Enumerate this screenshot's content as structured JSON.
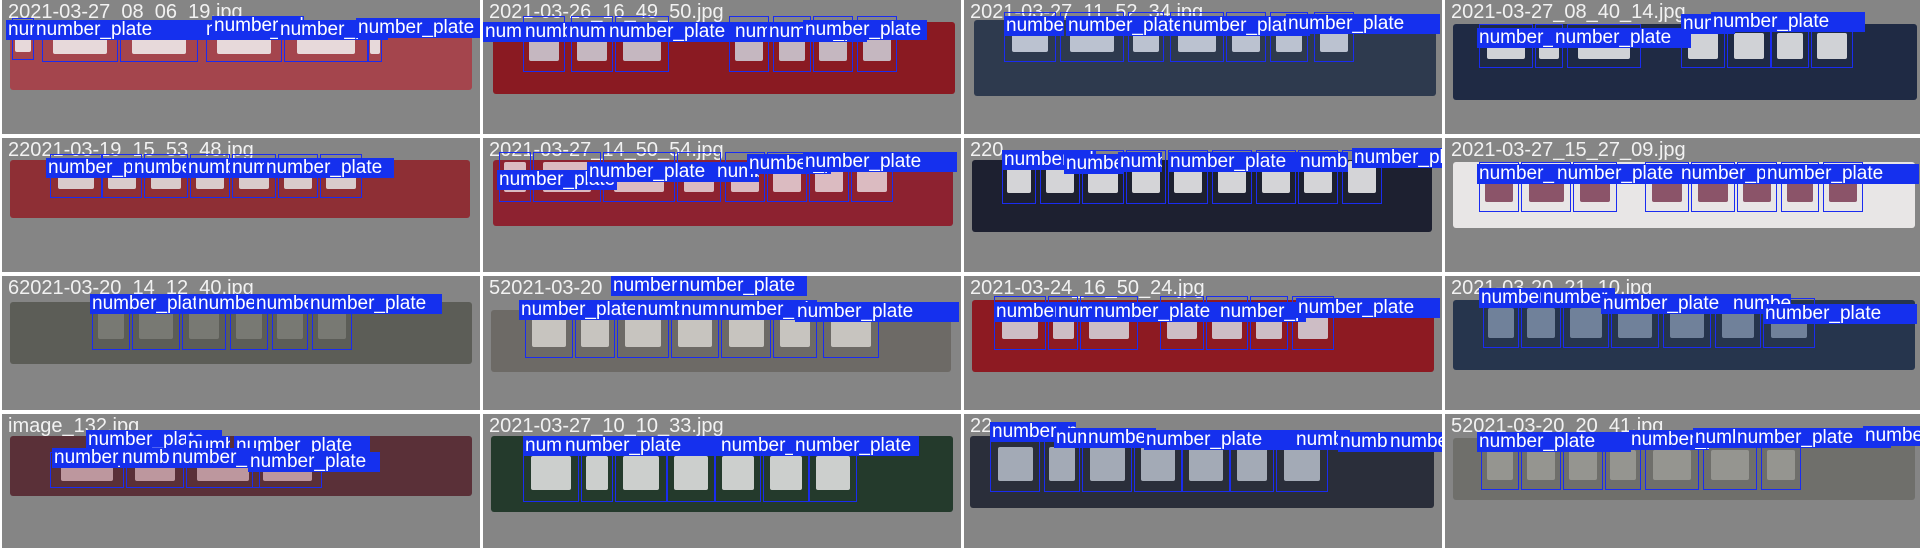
{
  "label_text": "number_plate",
  "colors": {
    "box": "#1a2cf0",
    "tag_bg": "#1530ee",
    "tag_text": "#ffffff",
    "tile_bg": "#858585",
    "filename_text": "#f2f2f2"
  },
  "tiles": [
    {
      "filename": "2021-03-27_08_06_19.jpg",
      "plate_color": "#a4454d",
      "glyph_color": "#f3f3f3"
    },
    {
      "filename": "2021-03-26_16_49_50.jpg",
      "plate_color": "#8a1a22",
      "glyph_color": "#cfd3dc"
    },
    {
      "filename": "2021-03-27_11_52_34.jpg",
      "plate_color": "#2e3a4e",
      "glyph_color": "#d4dbe8"
    },
    {
      "filename": "2021-03-27_08_40_14.jpg",
      "plate_color": "#1f2a44",
      "glyph_color": "#f0f0f0"
    },
    {
      "filename": "22021-03-19_15_53_48.jpg",
      "plate_color": "#8e2f35",
      "glyph_color": "#e6e6e6"
    },
    {
      "filename": "2021-03-27_14_50_54.jpg",
      "plate_color": "#8d2230",
      "glyph_color": "#e9d6da"
    },
    {
      "filename": "220",
      "plate_color": "#1d2030",
      "glyph_color": "#f4f4f4"
    },
    {
      "filename": "2021-03-27_15_27_09.jpg",
      "plate_color": "#e8e6e6",
      "glyph_color": "#7a3a52"
    },
    {
      "filename": "62021-03-20_14_12_40.jpg",
      "plate_color": "#5c5d57",
      "glyph_color": "#7d7e78"
    },
    {
      "filename": "52021-03-20",
      "plate_color": "#6d6a66",
      "glyph_color": "#d7d4cf"
    },
    {
      "filename": "2021-03-24_16_50_24.jpg",
      "plate_color": "#8d1a22",
      "glyph_color": "#d8dbe2"
    },
    {
      "filename": "2021-03-20_21_10.jpg",
      "plate_color": "#26354d",
      "glyph_color": "#7e8ea8"
    },
    {
      "filename": "image_132.jpg",
      "plate_color": "#5a3038",
      "glyph_color": "#cfa9b0"
    },
    {
      "filename": "2021-03-27_10_10_33.jpg",
      "plate_color": "#243a2c",
      "glyph_color": "#eaeaea"
    },
    {
      "filename": "22",
      "plate_color": "#2a2e3a",
      "glyph_color": "#b8bfcc"
    },
    {
      "filename": "52021-03-20_20_41.jpg",
      "plate_color": "#6f6f6b",
      "glyph_color": "#9c9c96"
    }
  ]
}
